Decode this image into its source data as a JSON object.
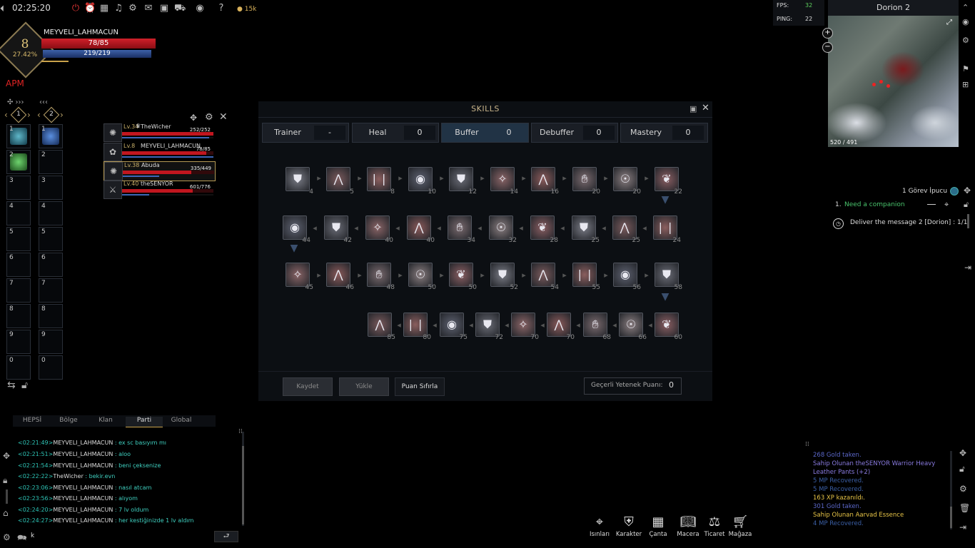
{
  "topbar": {
    "clock": "02:25:20",
    "icons": [
      "power-icon",
      "alarm-icon",
      "calendar-icon",
      "music-icon",
      "settings-icon",
      "mail-icon",
      "event-icon",
      "shop-cart-icon",
      "eye-icon",
      "help-icon"
    ],
    "gold": "15k"
  },
  "player": {
    "name": "MEYVELI_LAHMACUN",
    "level": "8",
    "xp_percent": "27.42%",
    "hp": "78/85",
    "hp_fraction": 0.918,
    "mp": "219/219",
    "mp_fraction": 1.0
  },
  "apm": "APM",
  "hotbars": {
    "bar1_index": "1",
    "bar2_index": "2",
    "slots": [
      "1",
      "2",
      "3",
      "4",
      "5",
      "6",
      "7",
      "8",
      "9",
      "0"
    ]
  },
  "party": [
    {
      "lv": "Lv.34",
      "name": "TheWicher",
      "hp": "252/252",
      "hp_fraction": 1.0,
      "mp_fraction": 0.95
    },
    {
      "lv": "Lv.8",
      "name": "MEYVELI_LAHMACUN",
      "hp": "78/85",
      "hp_fraction": 0.92,
      "mp_fraction": 1.0
    },
    {
      "lv": "Lv.38",
      "name": "Abuda",
      "hp": "335/449",
      "hp_fraction": 0.75,
      "mp_fraction": 0.4
    },
    {
      "lv": "Lv.40",
      "name": "theSENYOR",
      "hp": "601/776",
      "hp_fraction": 0.77,
      "mp_fraction": 0.3
    }
  ],
  "skills_window": {
    "title": "SKILLS",
    "tabs": [
      {
        "label": "Trainer",
        "value": "-"
      },
      {
        "label": "Heal",
        "value": "0"
      },
      {
        "label": "Buffer",
        "value": "0"
      },
      {
        "label": "Debuffer",
        "value": "0"
      },
      {
        "label": "Mastery",
        "value": "0"
      }
    ],
    "row1": [
      "4",
      "5",
      "8",
      "10",
      "12",
      "14",
      "16",
      "20",
      "20",
      "22"
    ],
    "row2": [
      "44",
      "42",
      "40",
      "40",
      "34",
      "32",
      "28",
      "25",
      "25",
      "24"
    ],
    "row3": [
      "45",
      "46",
      "48",
      "50",
      "50",
      "52",
      "54",
      "55",
      "56",
      "58"
    ],
    "row4": [
      "85",
      "80",
      "75",
      "72",
      "70",
      "70",
      "68",
      "66",
      "60"
    ],
    "buttons": {
      "save": "Kaydet",
      "load": "Yükle",
      "reset": "Puan Sıfırla"
    },
    "points_label": "Geçerli Yetenek Puanı:",
    "points_value": "0"
  },
  "stats": {
    "fps_label": "FPS:",
    "fps": "32",
    "ping_label": "PING:",
    "ping": "22"
  },
  "map": {
    "title": "Dorion 2",
    "coords": "520 / 491"
  },
  "quest": {
    "header": "1 Görev İpucu",
    "num": "1.",
    "name": "Need a companion",
    "task": "Deliver the message 2 [Dorion] : 1/1"
  },
  "chat": {
    "tabs": [
      "HEPSİ",
      "Bölge",
      "Klan",
      "Parti",
      "Global"
    ],
    "active_tab": "Parti",
    "lines": [
      {
        "time": "<02:21:49>",
        "name": "MEYVELI_LAHMACUN",
        "text": " : ex sc basıyım mı"
      },
      {
        "time": "<02:21:51>",
        "name": "MEYVELI_LAHMACUN",
        "text": " : aloo"
      },
      {
        "time": "<02:21:54>",
        "name": "MEYVELI_LAHMACUN",
        "text": " : beni çeksenize"
      },
      {
        "time": "<02:22:22>",
        "name": "TheWicher",
        "text": " : bekir.evn"
      },
      {
        "time": "<02:23:06>",
        "name": "MEYVELI_LAHMACUN",
        "text": " : nasıl atcam"
      },
      {
        "time": "<02:23:56>",
        "name": "MEYVELI_LAHMACUN",
        "text": " : alıyom"
      },
      {
        "time": "<02:24:20>",
        "name": "MEYVELI_LAHMACUN",
        "text": " : 7 lv oldum"
      },
      {
        "time": "<02:24:27>",
        "name": "MEYVELI_LAHMACUN",
        "text": " : her kestiğinizde 1 lv aldım"
      }
    ],
    "input_value": "k"
  },
  "loot_log": [
    {
      "text": "268 Gold taken.",
      "color": "#5b67c9"
    },
    {
      "text": "Sahip Olunan theSENYOR  Warrior Heavy",
      "color": "#8a7be0"
    },
    {
      "text": "Leather Pants (+2)",
      "color": "#8a7be0"
    },
    {
      "text": "5 MP Recovered.",
      "color": "#3b5fa6"
    },
    {
      "text": "5 MP Recovered.",
      "color": "#3b5fa6"
    },
    {
      "text": "163 XP kazanıldı.",
      "color": "#e8c547"
    },
    {
      "text": "301 Gold taken.",
      "color": "#5b67c9"
    },
    {
      "text": "Sahip Olunan Aarvad Essence",
      "color": "#e8c547"
    },
    {
      "text": "4 MP Recovered.",
      "color": "#3b5fa6"
    }
  ],
  "bottom_menu": [
    {
      "label": "Isınları",
      "icon": "teleport-icon"
    },
    {
      "label": "Karakter",
      "icon": "character-icon"
    },
    {
      "label": "Çanta",
      "icon": "bag-icon"
    },
    {
      "label": "Macera",
      "icon": "adventure-book-icon"
    },
    {
      "label": "Ticaret",
      "icon": "trade-scale-icon"
    },
    {
      "label": "Mağaza",
      "icon": "store-cart-icon"
    }
  ]
}
